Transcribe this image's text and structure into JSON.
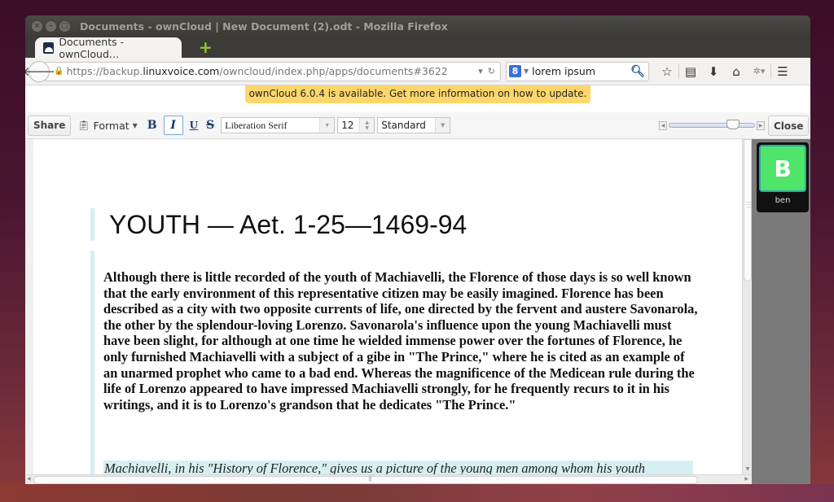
{
  "window": {
    "title": "Documents - ownCloud | New Document (2).odt - Mozilla Firefox",
    "controls": [
      "close",
      "minimize",
      "maximize"
    ]
  },
  "tabs": [
    {
      "label": "Documents - ownCloud…",
      "icon": "owncloud-icon",
      "active": true
    }
  ],
  "new_tab_label": "+",
  "navbar": {
    "url_prefix": "https://backup.",
    "url_host": "linuxvoice.com",
    "url_path": "/owncloud/index.php/apps/documents#3622",
    "search_engine_icon": "8",
    "search_value": "lorem ipsum",
    "icons": [
      "bookmark-star-icon",
      "reading-list-icon",
      "download-icon",
      "home-icon",
      "addon-icon",
      "menu-icon"
    ]
  },
  "notice": {
    "text": "ownCloud 6.0.4 is available. Get more information on how to update.",
    "color": "#fed76b"
  },
  "toolbar": {
    "share_label": "Share",
    "format_label": "Format",
    "bold_label": "B",
    "italic_label": "I",
    "underline_label": "U",
    "strike_label": "S",
    "font_family": "Liberation Serif",
    "font_size": "12",
    "paragraph_style": "Standard",
    "zoom_level": 0.8,
    "close_label": "Close"
  },
  "document": {
    "heading": "YOUTH — Aet. 1-25—1469-94",
    "paragraph1": "Although there is little recorded of the youth of Machiavelli, the Florence of those days is so well known that the early environment of this representative citizen may be easily imagined. Florence has been described as a city with two opposite currents of life, one directed by the fervent and austere Savonarola, the other by the splendour-loving Lorenzo. Savonarola's influence upon the young Machiavelli must have been slight, for although at one time he wielded immense power over the fortunes of Florence, he only furnished Machiavelli with a subject of a gibe in \"The Prince,\" where he is cited as an example of an unarmed prophet who came to a bad end. Whereas the magnificence of the Medicean rule during the life of Lorenzo appeared to have impressed Machiavelli strongly, for he frequently recurs to it in his writings, and it is to Lorenzo's grandson that he dedicates \"The Prince.\"",
    "paragraph2": "Machiavelli, in his \"History of Florence,\" gives us a picture of the young men among whom his youth"
  },
  "session": {
    "users": [
      {
        "initial": "B",
        "name": "ben",
        "color": "#4fe46a"
      }
    ]
  }
}
